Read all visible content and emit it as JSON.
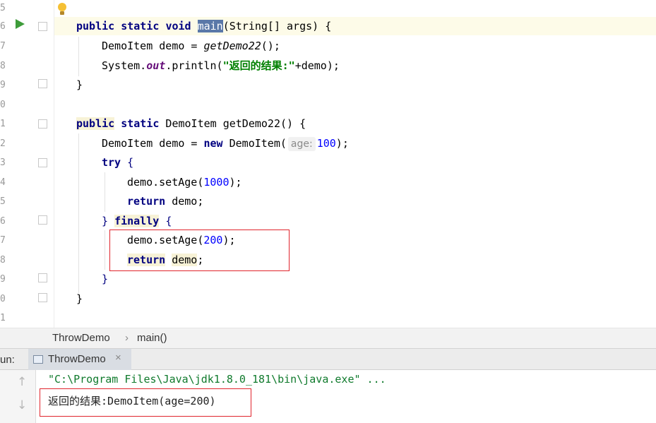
{
  "editor": {
    "line_numbers": [
      "5",
      "6",
      "7",
      "8",
      "9",
      "0",
      "1",
      "2",
      "3",
      "4",
      "5",
      "6",
      "7",
      "8",
      "9",
      "0",
      "1"
    ],
    "lines": [
      "",
      "public static void main(String[] args) {",
      "DemoItem demo = getDemo22();",
      "System.out.println(\"返回的结果:\"+demo);",
      "}",
      "",
      "public static DemoItem getDemo22() {",
      "DemoItem demo = new DemoItem( age: 100);",
      "try {",
      "demo.setAge(1000);",
      "return demo;",
      "} finally {",
      "demo.setAge(200);",
      "return demo;",
      "}",
      "}",
      ""
    ],
    "tokens": {
      "public": "public",
      "static": "static",
      "void": "void",
      "main": "main",
      "main_rest": "(String[] args) {",
      "l7_a": "DemoItem demo = ",
      "l7_call": "getDemo22",
      "l7_b": "();",
      "l8_a": "System.",
      "l8_out": "out",
      "l8_b": ".println(",
      "l8_str": "\"返回的结果:\"",
      "l8_c": "+demo);",
      "close": "}",
      "l11_type": " DemoItem getDemo22() {",
      "l12_a": "DemoItem demo = ",
      "new": "new",
      "l12_b": " DemoItem(",
      "hint": "age:",
      "l12_num": "100",
      "l12_c": ");",
      "try": "try",
      "open_brace": "{",
      "l14_a": "demo.setAge(",
      "l14_num": "1000",
      "l14_b": ");",
      "return": "return",
      "demo_semi": " demo;",
      "finally": "finally",
      "l17_num": "200",
      "demo_word": "demo",
      "semi": ";"
    },
    "accent_colors": {
      "keyword": "#000080",
      "number": "#0000ff",
      "string": "#008000",
      "field": "#660e7a",
      "highlight": "#e0242c"
    }
  },
  "breadcrumb": {
    "items": [
      "ThrowDemo",
      "main()"
    ],
    "separator": "›"
  },
  "run_panel": {
    "label": "un:",
    "tab": {
      "label": "ThrowDemo",
      "close": "×"
    },
    "console": {
      "command": "\"C:\\Program Files\\Java\\jdk1.8.0_181\\bin\\java.exe\" ...",
      "output": "返回的结果:DemoItem(age=200)"
    },
    "icons": [
      "up-arrow-icon",
      "down-arrow-icon"
    ]
  }
}
